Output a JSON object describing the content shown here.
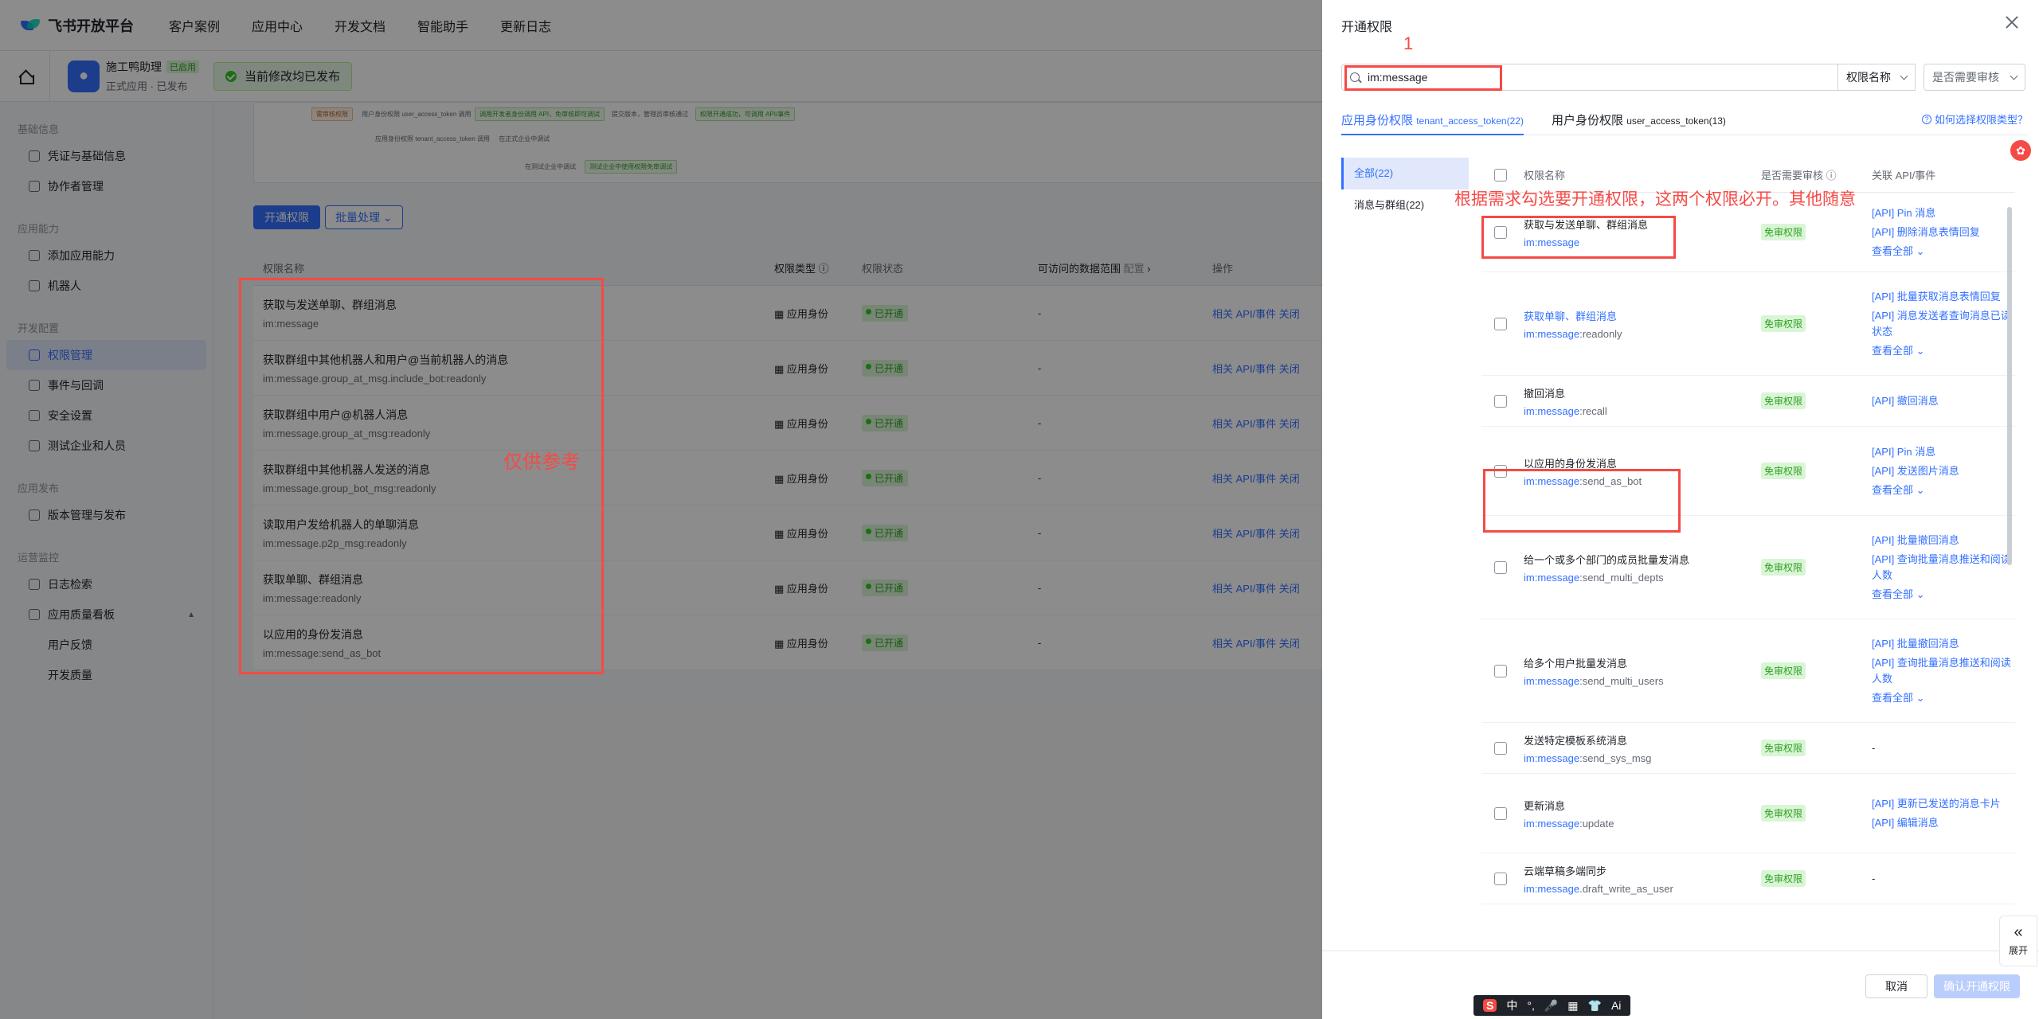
{
  "topnav": {
    "logo": "飞书开放平台",
    "items": [
      "客户案例",
      "应用中心",
      "开发文档",
      "智能助手",
      "更新日志"
    ]
  },
  "app": {
    "name": "施工鸭助理",
    "badge": "已启用",
    "sub": "正式应用 · 已发布",
    "published": "当前修改均已发布"
  },
  "sidebar": {
    "groups": [
      {
        "title": "基础信息",
        "items": [
          "凭证与基础信息",
          "协作者管理"
        ]
      },
      {
        "title": "应用能力",
        "items": [
          "添加应用能力",
          "机器人"
        ]
      },
      {
        "title": "开发配置",
        "items": [
          "权限管理",
          "事件与回调",
          "安全设置",
          "测试企业和人员"
        ]
      },
      {
        "title": "应用发布",
        "items": [
          "版本管理与发布"
        ]
      },
      {
        "title": "运营监控",
        "items": [
          "日志检索",
          "应用质量看板",
          "用户反馈",
          "开发质量"
        ]
      }
    ]
  },
  "flow": {
    "chip1": "需审核权限",
    "row1_text": "用户身份权限 user_access_token 调用",
    "row1_chip_green": "调用开发者身份调用 API，免审核即可调试",
    "row1_after": "提交版本，管理员审核通过",
    "row1_chip_green2": "权限开通成功，可调用 API/事件",
    "row2_text": "应用身份权限 tenant_access_token 调用",
    "row2_after": "在正式企业中调试",
    "row3_after": "在测试企业中调试",
    "row3_chip": "测试企业中使用权限免审调试"
  },
  "main": {
    "open_btn": "开通权限",
    "batch_btn": "批量处理",
    "headers": {
      "name": "权限名称",
      "type": "权限类型",
      "status": "权限状态",
      "scope": "可访问的数据范围",
      "scope_extra": "配置",
      "op": "操作"
    },
    "rows": [
      {
        "title": "获取与发送单聊、群组消息",
        "code": "im:message",
        "type": "应用身份",
        "status": "已开通",
        "scope": "-",
        "op": "相关 API/事件  关闭"
      },
      {
        "title": "获取群组中其他机器人和用户@当前机器人的消息",
        "code": "im:message.group_at_msg.include_bot:readonly",
        "type": "应用身份",
        "status": "已开通",
        "scope": "-",
        "op": "相关 API/事件  关闭"
      },
      {
        "title": "获取群组中用户@机器人消息",
        "code": "im:message.group_at_msg:readonly",
        "type": "应用身份",
        "status": "已开通",
        "scope": "-",
        "op": "相关 API/事件  关闭"
      },
      {
        "title": "获取群组中其他机器人发送的消息",
        "code": "im:message.group_bot_msg:readonly",
        "type": "应用身份",
        "status": "已开通",
        "scope": "-",
        "op": "相关 API/事件  关闭"
      },
      {
        "title": "读取用户发给机器人的单聊消息",
        "code": "im:message.p2p_msg:readonly",
        "type": "应用身份",
        "status": "已开通",
        "scope": "-",
        "op": "相关 API/事件  关闭"
      },
      {
        "title": "获取单聊、群组消息",
        "code": "im:message:readonly",
        "type": "应用身份",
        "status": "已开通",
        "scope": "-",
        "op": "相关 API/事件  关闭"
      },
      {
        "title": "以应用的身份发消息",
        "code": "im:message:send_as_bot",
        "type": "应用身份",
        "status": "已开通",
        "scope": "-",
        "op": "相关 API/事件  关闭"
      }
    ]
  },
  "annotations": {
    "ref_only": "仅供参考",
    "step1": "1",
    "hint": "根据需求勾选要开通权限，这两个权限必开。其他随意"
  },
  "drawer": {
    "title": "开通权限",
    "search_value": "im:message",
    "select1": "权限名称",
    "select2": "是否需要审核",
    "tab1": "应用身份权限",
    "tab1_small": "tenant_access_token(22)",
    "tab2": "用户身份权限",
    "tab2_small": "user_access_token(13)",
    "help": "如何选择权限类型？",
    "cats": [
      "全部(22)",
      "消息与群组(22)"
    ],
    "headers": {
      "name": "权限名称",
      "audit": "是否需要审核",
      "api": "关联 API/事件"
    },
    "perms": [
      {
        "title": "获取与发送单聊、群组消息",
        "code_key": "im:message",
        "code_rest": "",
        "audit": "免审权限",
        "apis": [
          "[API] Pin 消息",
          "[API] 删除消息表情回复"
        ],
        "more": "查看全部"
      },
      {
        "title": "获取单聊、群组消息",
        "code_key": "im:message",
        "code_rest": ":readonly",
        "audit": "免审权限",
        "apis": [
          "[API] 批量获取消息表情回复",
          "[API] 消息发送者查询消息已读状态"
        ],
        "more": "查看全部"
      },
      {
        "title": "撤回消息",
        "code_key": "im:message",
        "code_rest": ":recall",
        "audit": "免审权限",
        "apis": [
          "[API] 撤回消息"
        ],
        "more": ""
      },
      {
        "title": "以应用的身份发消息",
        "code_key": "im:message",
        "code_rest": ":send_as_bot",
        "audit": "免审权限",
        "apis": [
          "[API] Pin 消息",
          "[API] 发送图片消息"
        ],
        "more": "查看全部"
      },
      {
        "title": "给一个或多个部门的成员批量发消息",
        "code_key": "im:message",
        "code_rest": ":send_multi_depts",
        "audit": "免审权限",
        "apis": [
          "[API] 批量撤回消息",
          "[API] 查询批量消息推送和阅读人数"
        ],
        "more": "查看全部"
      },
      {
        "title": "给多个用户批量发消息",
        "code_key": "im:message",
        "code_rest": ":send_multi_users",
        "audit": "免审权限",
        "apis": [
          "[API] 批量撤回消息",
          "[API] 查询批量消息推送和阅读人数"
        ],
        "more": "查看全部"
      },
      {
        "title": "发送特定模板系统消息",
        "code_key": "im:message",
        "code_rest": ":send_sys_msg",
        "audit": "免审权限",
        "apis": [],
        "more": ""
      },
      {
        "title": "更新消息",
        "code_key": "im:message",
        "code_rest": ":update",
        "audit": "免审权限",
        "apis": [
          "[API] 更新已发送的消息卡片",
          "[API] 编辑消息"
        ],
        "more": ""
      },
      {
        "title": "云端草稿多端同步",
        "code_key": "im:message",
        "code_rest": ".draft_write_as_user",
        "audit": "免审权限",
        "apis": [],
        "more": ""
      }
    ],
    "cancel": "取消",
    "confirm": "确认开通权限",
    "expand": "展开"
  },
  "ime": [
    "中",
    "°,",
    "🎤",
    "▦",
    "👕",
    "Ai"
  ]
}
